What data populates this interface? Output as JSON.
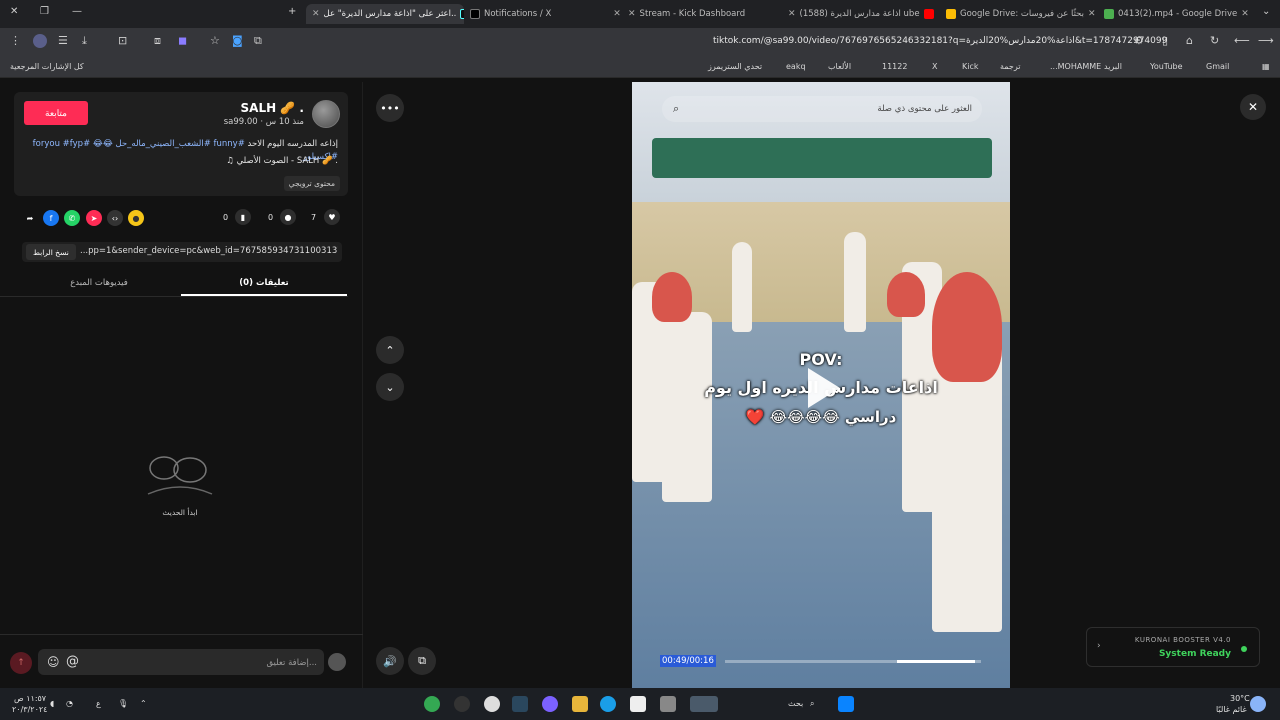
{
  "tabs": [
    {
      "title": "0413(2).mp4 - Google Drive",
      "color": "#4caf50"
    },
    {
      "title": "Google Drive: بحثًا عن فيروسات",
      "color": "#fbbc05"
    },
    {
      "title": "(1588) اذاعة مدارس الديرة ube",
      "color": "#ff0000"
    },
    {
      "title": "Stream - Kick Dashboard",
      "color": "#53fc18"
    },
    {
      "title": "Notifications / X",
      "color": "#ffffff"
    },
    {
      "title": "اعثر على \"اذاعة مدارس الديرة\" عل..",
      "color": "#ffffff"
    }
  ],
  "url": "tiktok.com/@sa99.00/video/7676976565246332181?q=اذاعة%20مدارس%20الديرة&t=1787472974099",
  "bookmarks": {
    "all": "كل الإشارات المرجعية",
    "items": [
      "Gmail",
      "YouTube",
      "البريد",
      "...MOHAMME",
      "ترجمة",
      "Kick",
      "X",
      "11122",
      "الألعاب",
      "eakq",
      "تحدي الستريمرز"
    ]
  },
  "video_post": {
    "follow_label": "متابعة",
    "username": "SALH 🥜 .",
    "handle": "sa99.00 · منذ 10 س",
    "caption_text": "إذاعه المدرسه اليوم الاحد",
    "caption_tags": "#funny #الشعب_الصيني_ماله_حل 😂😂 #foryou #fyp #اكسبلور",
    "music": "♫ الصوت الأصلي - SALH 🥜 .",
    "music_badge": "محتوى ترويجي",
    "likes": "7",
    "comments": "0",
    "saves": "0",
    "copy_link_label": "نسخ الرابط",
    "share_link": "...pp=1&sender_device=pc&web_id=7675859347311003137",
    "tab_comments": "تعليقات (0)",
    "tab_creator_videos": "فيديوهات المبدع",
    "empty_state": "ابدأ الحديث",
    "comment_placeholder": "إضافة تعليق..."
  },
  "video": {
    "search_placeholder": "العثور على محتوى ذي صلة",
    "pov_text": "POV:",
    "overlay_line1": "اذاعات مدارس الديره اول يوم",
    "overlay_line2": "دراسي 😂😂😂😂 ❤️",
    "time": "00:49/00:16",
    "progress": 0.67
  },
  "booster": {
    "name": "KURONAI BOOSTER V4.0",
    "status": "System Ready",
    "color": "#3fd35c"
  },
  "taskbar": {
    "search": "بحث",
    "weather_temp": "30°C",
    "weather_desc": "غائم غالبًا",
    "time": "١١:٥٧ ص",
    "date": "٢٠/٣/٢٠٢٤"
  }
}
